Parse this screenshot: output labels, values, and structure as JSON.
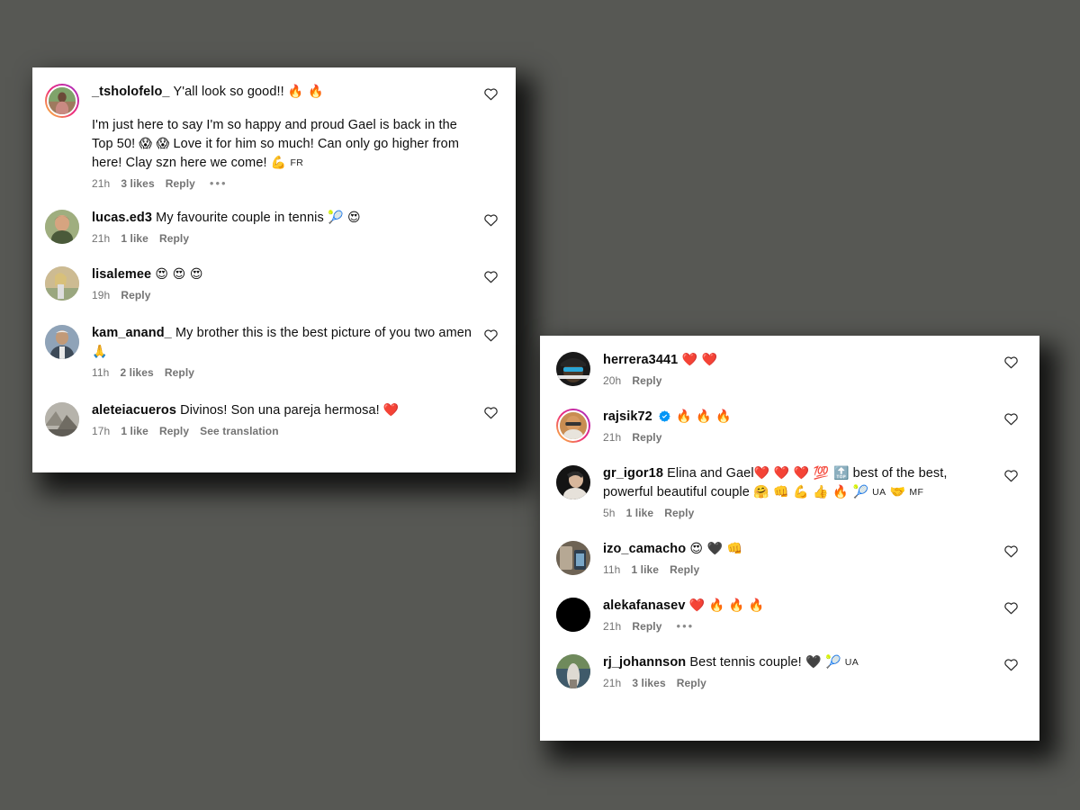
{
  "background_color": "#575854",
  "panel_background": "#ffffff",
  "panels": [
    {
      "id": "comments-panel-left",
      "comments": [
        {
          "username": "_tsholofelo_",
          "verified": false,
          "avatar_ring": true,
          "avatar_type": "photo-woman",
          "text_line1": "Y'all look so good!!",
          "emoji_line1": "🔥 🔥",
          "body": "I'm just here to say I'm so happy and proud Gael is back in the Top 50!",
          "body_emoji": "😱 😱",
          "body2": "Love it for him so much! Can only go higher from here! Clay szn here we come!",
          "body2_emoji": "💪",
          "flag": "FR",
          "time": "21h",
          "likes": "3 likes",
          "reply": "Reply",
          "has_dots": true,
          "liked": false
        },
        {
          "username": "lucas.ed3",
          "verified": false,
          "avatar_ring": false,
          "avatar_type": "photo-man-green",
          "text_line1": "My favourite couple in tennis",
          "emoji_line1": "🎾 😍",
          "time": "21h",
          "likes": "1 like",
          "reply": "Reply",
          "has_dots": false,
          "liked": false
        },
        {
          "username": "lisalemee",
          "verified": false,
          "avatar_ring": false,
          "avatar_type": "photo-beach",
          "text_line1": "",
          "emoji_line1": "😍 😍 😍",
          "time": "19h",
          "likes": "",
          "reply": "Reply",
          "has_dots": false,
          "liked": false
        },
        {
          "username": "kam_anand_",
          "verified": false,
          "avatar_ring": false,
          "avatar_type": "photo-man-suit",
          "text_line1": "My brother this is the best picture of you two amen",
          "emoji_line1": "🙏",
          "time": "11h",
          "likes": "2 likes",
          "reply": "Reply",
          "has_dots": false,
          "liked": false
        },
        {
          "username": "aleteiacueros",
          "verified": false,
          "avatar_ring": false,
          "avatar_type": "photo-grey",
          "text_line1": "Divinos! Son una pareja hermosa!",
          "emoji_line1": "❤️",
          "time": "17h",
          "likes": "1 like",
          "reply": "Reply",
          "translation": "See translation",
          "has_dots": false,
          "liked": false
        }
      ]
    },
    {
      "id": "comments-panel-right",
      "comments": [
        {
          "username": "herrera3441",
          "verified": false,
          "avatar_ring": false,
          "avatar_type": "photo-sunglasses",
          "text_line1": "",
          "emoji_line1": "❤️ ❤️",
          "time": "20h",
          "likes": "",
          "reply": "Reply",
          "has_dots": false,
          "liked": false
        },
        {
          "username": "rajsik72",
          "verified": true,
          "avatar_ring": true,
          "avatar_type": "photo-glasses-man",
          "text_line1": "",
          "emoji_line1": "🔥 🔥 🔥",
          "time": "21h",
          "likes": "",
          "reply": "Reply",
          "has_dots": false,
          "liked": false
        },
        {
          "username": "gr_igor18",
          "verified": false,
          "avatar_ring": false,
          "avatar_type": "photo-profile-dark",
          "text_line1": "Elina and Gael",
          "emoji_line1": "❤️ ❤️ ❤️ 💯 🔝",
          "text_line1b": "best of the best,",
          "body2": "powerful beautiful couple",
          "body2_emoji": "🤗 👊 💪 👍 🔥 🎾",
          "flag": "UA",
          "body2_emoji2": "🤝",
          "flag2": "MF",
          "time": "5h",
          "likes": "1 like",
          "reply": "Reply",
          "has_dots": false,
          "liked": false
        },
        {
          "username": "izo_camacho",
          "verified": false,
          "avatar_ring": false,
          "avatar_type": "photo-phone",
          "text_line1": "",
          "emoji_line1": "😍 🖤 👊",
          "time": "11h",
          "likes": "1 like",
          "reply": "Reply",
          "has_dots": false,
          "liked": false
        },
        {
          "username": "alekafanasev",
          "verified": false,
          "avatar_ring": false,
          "avatar_type": "solid-black",
          "text_line1": "",
          "emoji_line1": "❤️ 🔥 🔥 🔥",
          "time": "21h",
          "likes": "",
          "reply": "Reply",
          "has_dots": true,
          "liked": false
        },
        {
          "username": "rj_johannson",
          "verified": false,
          "avatar_ring": false,
          "avatar_type": "photo-water",
          "text_line1": "Best tennis couple!",
          "emoji_line1": "🖤 🎾",
          "flag": "UA",
          "time": "21h",
          "likes": "3 likes",
          "reply": "Reply",
          "has_dots": false,
          "liked": false
        }
      ]
    }
  ]
}
